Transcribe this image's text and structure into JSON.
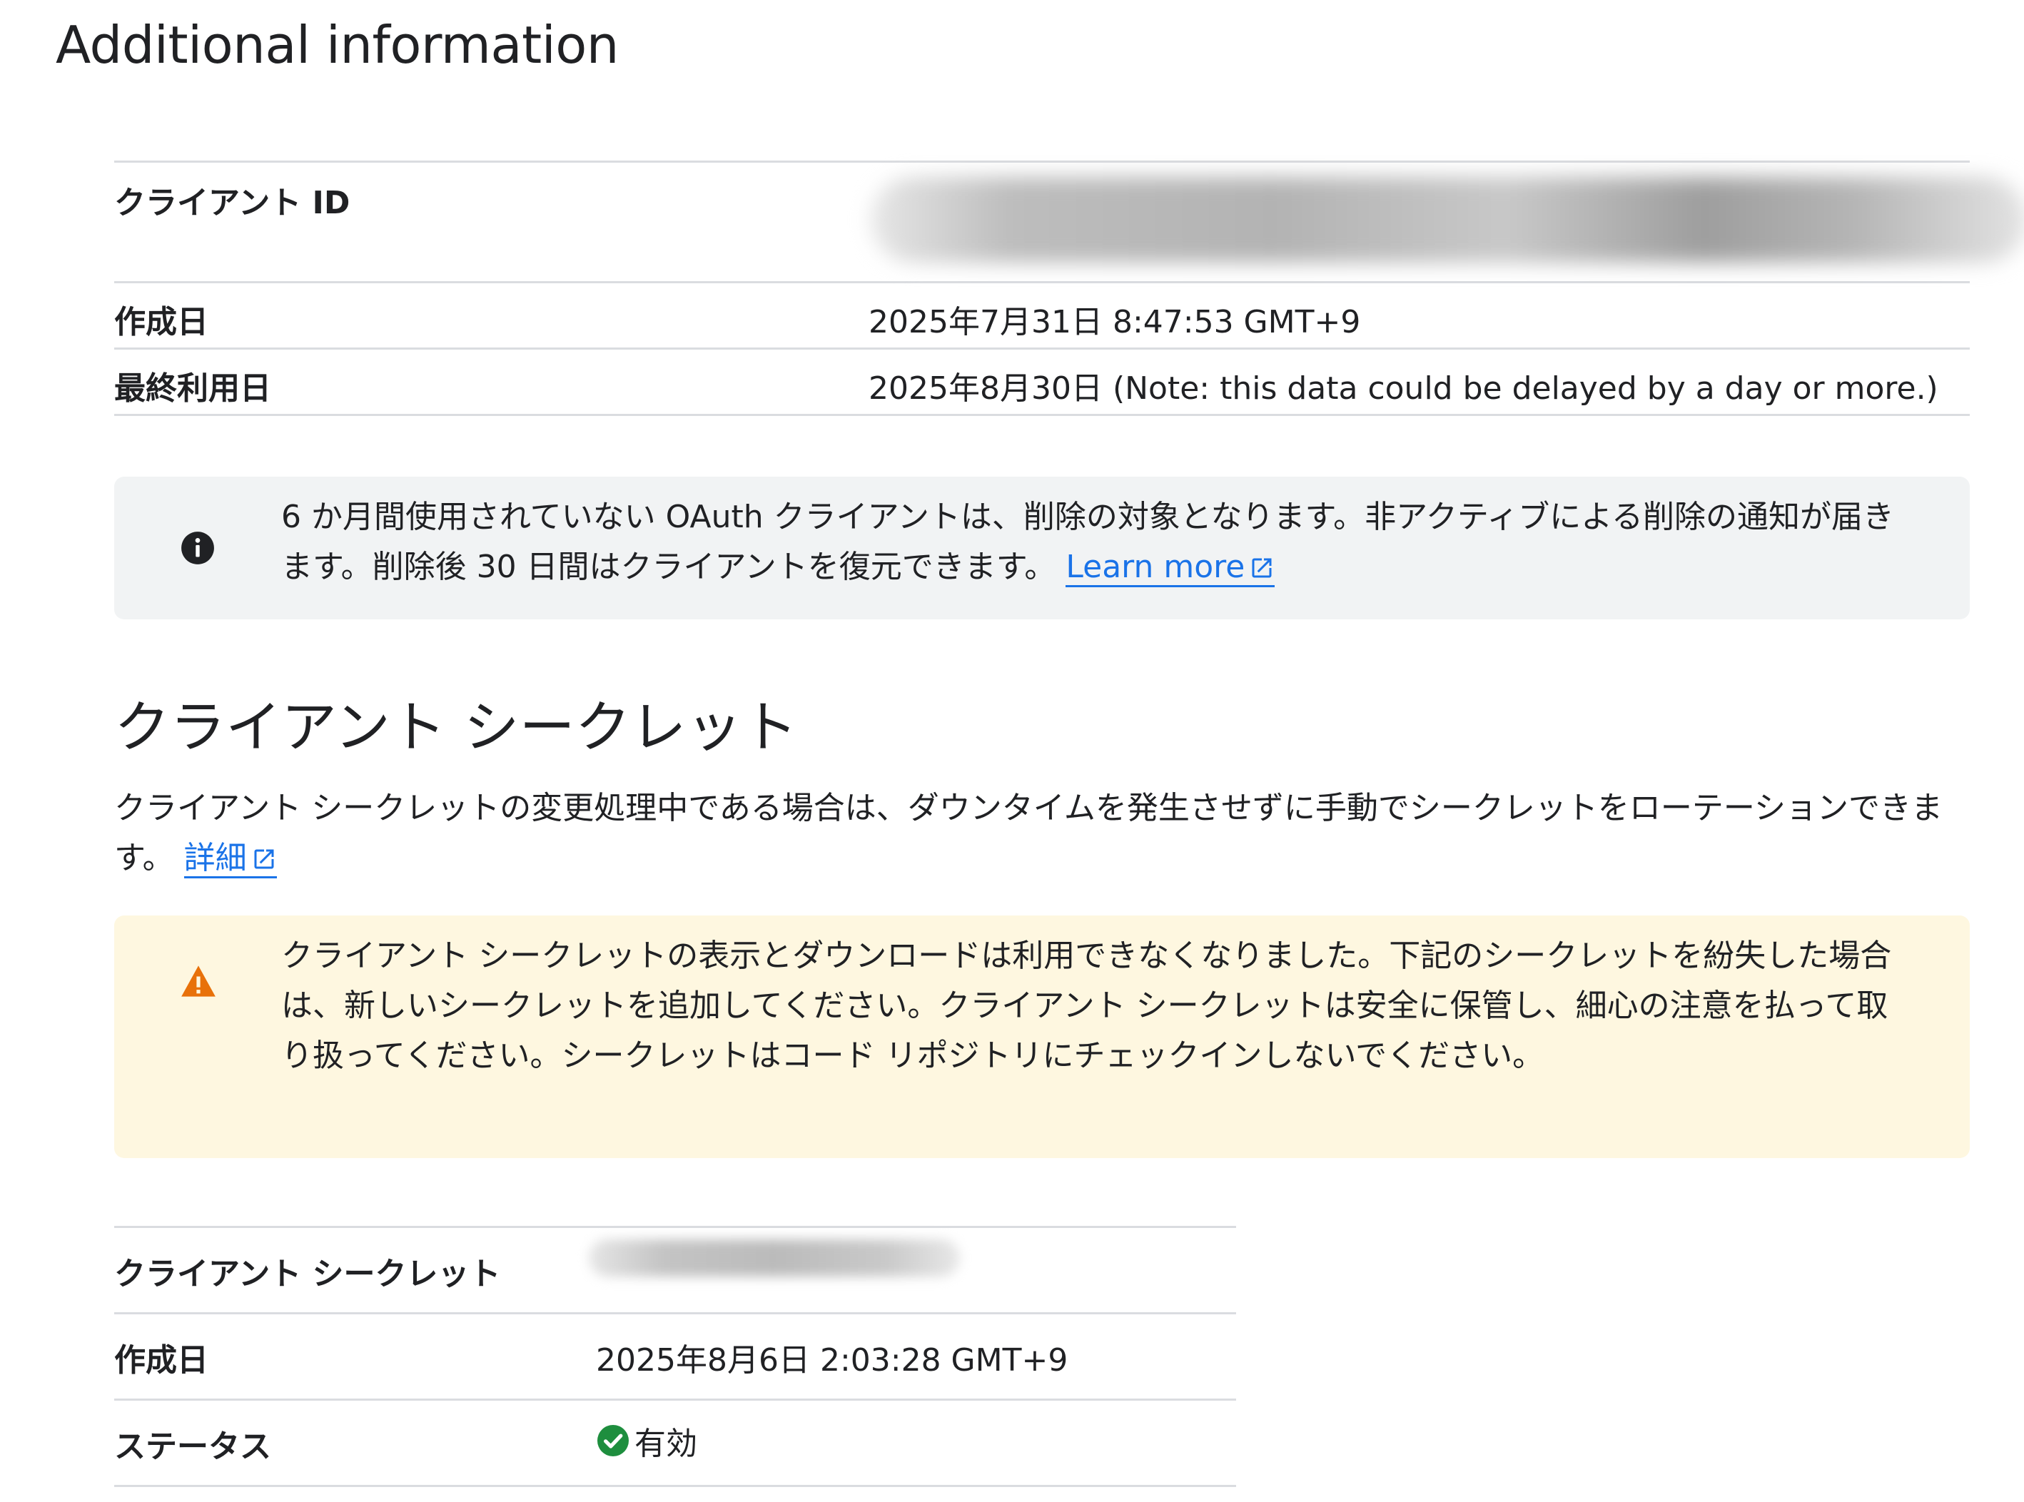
{
  "page": {
    "title": "Additional information"
  },
  "details": {
    "client_id_label": "クライアント ID",
    "created_label": "作成日",
    "created_value": "2025年7月31日 8:47:53 GMT+9",
    "last_used_label": "最終利用日",
    "last_used_value": "2025年8月30日 (Note: this data could be delayed by a day or more.)"
  },
  "info_banner": {
    "icon": "info-icon",
    "text": "6 か月間使用されていない OAuth クライアントは、削除の対象となります。非アクティブによる削除の通知が届きます。削除後 30 日間はクライアントを復元できます。",
    "link_label": "Learn more"
  },
  "secret_section": {
    "title": "クライアント シークレット",
    "description": "クライアント シークレットの変更処理中である場合は、ダウンタイムを発生させずに手動でシークレットをローテーションできます。",
    "link_label": "詳細"
  },
  "warning_banner": {
    "icon": "warning-icon",
    "text": "クライアント シークレットの表示とダウンロードは利用できなくなりました。下記のシークレットを紛失した場合は、新しいシークレットを追加してください。クライアント シークレットは安全に保管し、細心の注意を払って取り扱ってください。シークレットはコード リポジトリにチェックインしないでください。"
  },
  "secret_table": {
    "secret_label": "クライアント シークレット",
    "created_label": "作成日",
    "created_value": "2025年8月6日 2:03:28 GMT+9",
    "status_label": "ステータス",
    "status_value": "有効",
    "status_icon": "check-circle-icon"
  },
  "colors": {
    "link": "#1a73e8",
    "info_bg": "#f1f3f4",
    "warning_bg": "#fef7e0",
    "warning_icon": "#e8710a",
    "success_icon": "#1e8e3e",
    "divider": "#dadce0"
  }
}
